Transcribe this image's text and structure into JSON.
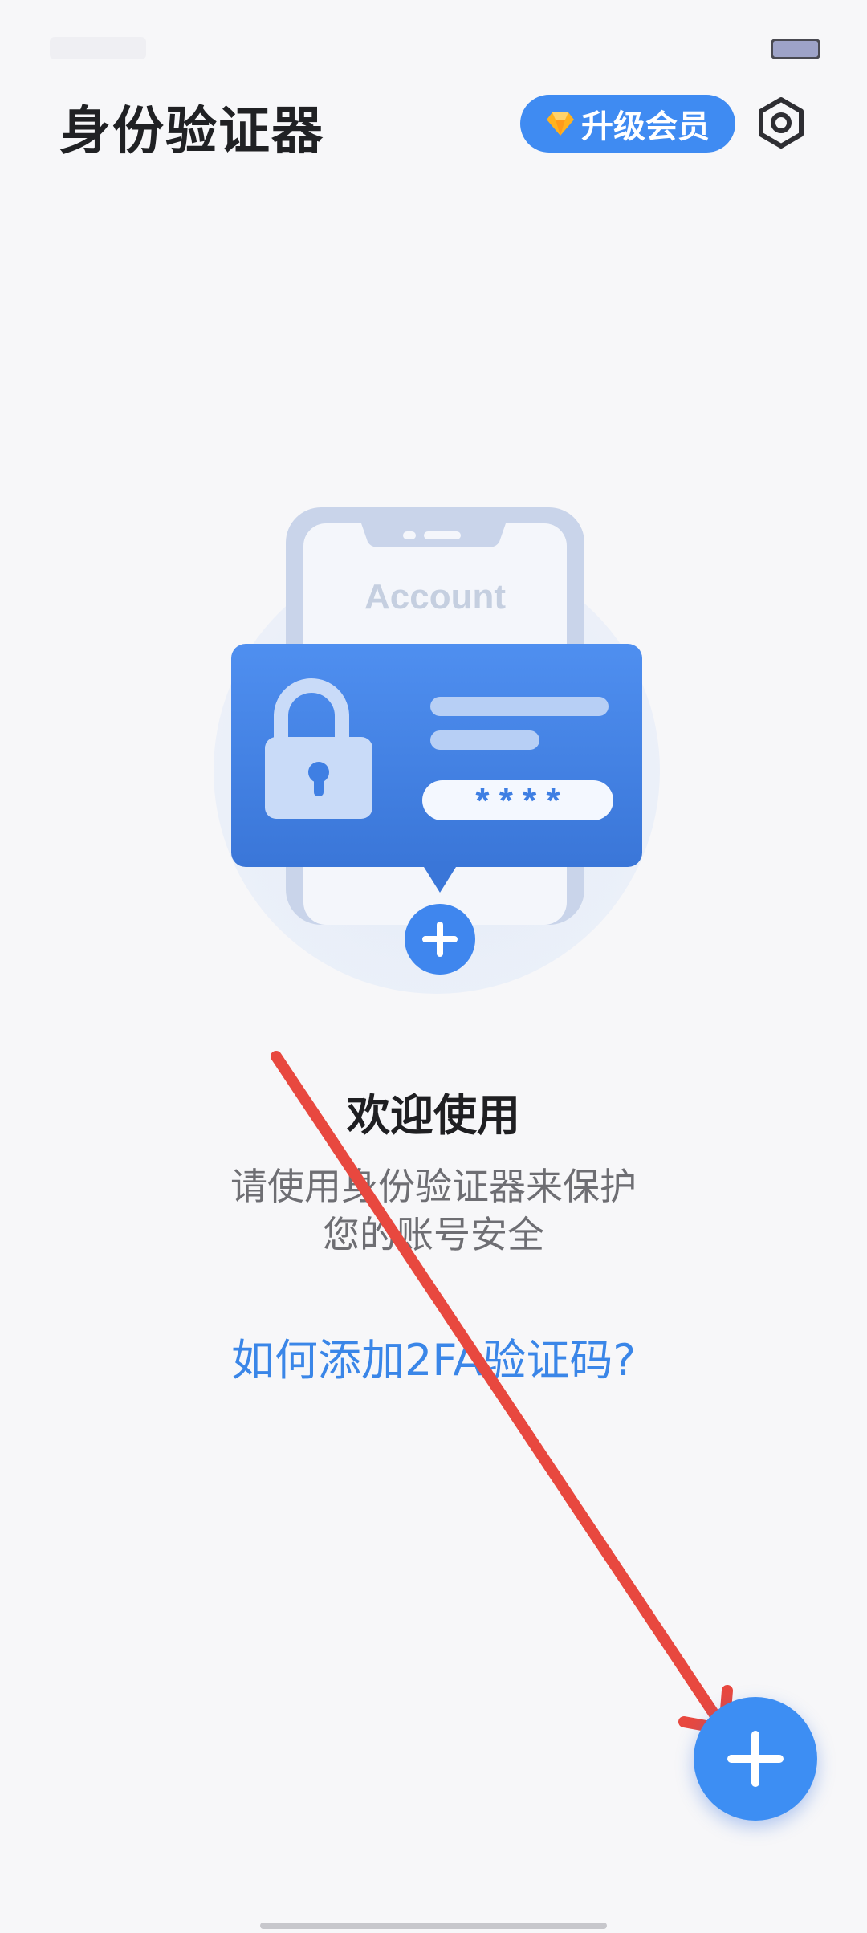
{
  "header": {
    "title": "身份验证器",
    "upgrade_label": "升级会员",
    "settings_icon": "gear-hex-icon"
  },
  "illustration": {
    "account_label": "Account",
    "password_mask": "* * * *"
  },
  "welcome": {
    "title": "欢迎使用",
    "description_line1": "请使用身份验证器来保护",
    "description_line2": "您的账号安全",
    "help_link": "如何添加2FA验证码?"
  },
  "fab": {
    "icon": "plus-icon"
  },
  "colors": {
    "accent": "#3f8bf2",
    "annotation_arrow": "#e8483f",
    "background": "#f7f7f9"
  }
}
